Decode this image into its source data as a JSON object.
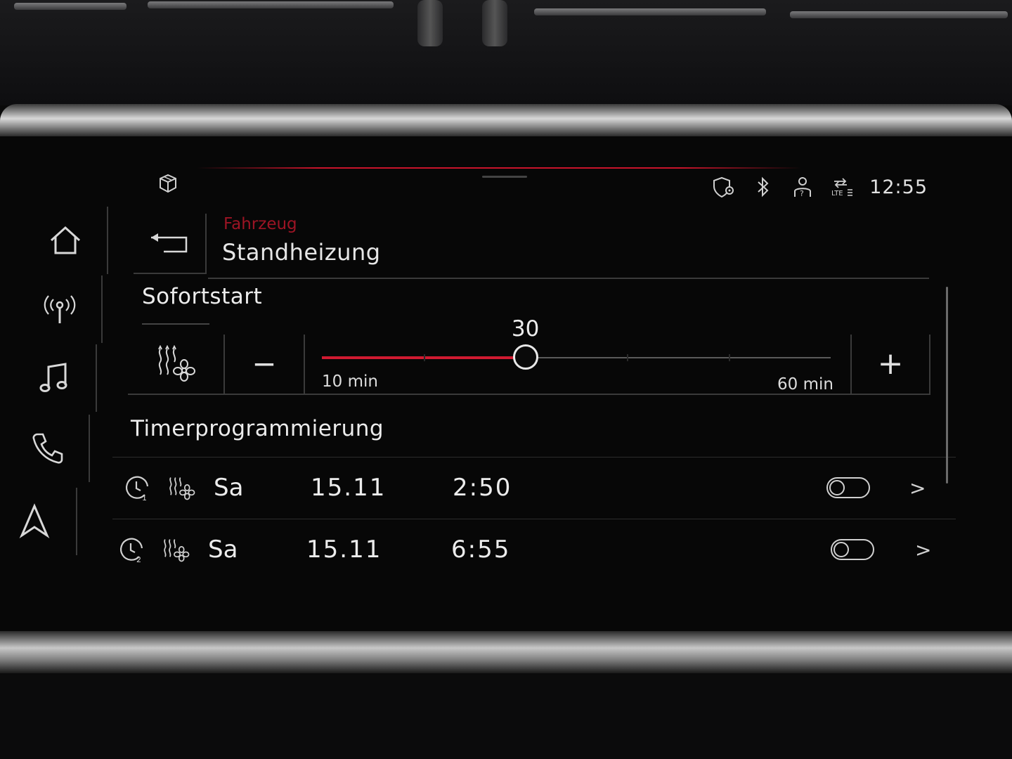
{
  "status_bar": {
    "time": "12:55",
    "icons": [
      "cube-icon",
      "shield-location-icon",
      "bluetooth-icon",
      "profile-help-icon",
      "lte-data-icon"
    ]
  },
  "nav": {
    "items": [
      {
        "name": "home-icon"
      },
      {
        "name": "radio-icon"
      },
      {
        "name": "music-icon"
      },
      {
        "name": "phone-icon"
      },
      {
        "name": "navigation-icon"
      }
    ]
  },
  "header": {
    "breadcrumb": "Fahrzeug",
    "title": "Standheizung",
    "back_icon": "back-arrow-icon"
  },
  "sofortstart": {
    "title": "Sofortstart",
    "mode_icon": "heater-fan-icon",
    "minus_label": "−",
    "plus_label": "+",
    "slider": {
      "value": 30,
      "value_label": "30",
      "min": 10,
      "max": 60,
      "min_label": "10 min",
      "max_label": "60 min"
    }
  },
  "timers": {
    "title": "Timerprogrammierung",
    "rows": [
      {
        "clock_icon": "timer-1-icon",
        "mode_icon": "heater-fan-icon",
        "day": "Sa",
        "date": "15.11",
        "time": "2:50",
        "enabled": false,
        "chevron": ">"
      },
      {
        "clock_icon": "timer-2-icon",
        "mode_icon": "heater-fan-icon",
        "day": "Sa",
        "date": "15.11",
        "time": "6:55",
        "enabled": false,
        "chevron": ">"
      }
    ]
  },
  "colors": {
    "accent_red": "#d01a30",
    "text": "#ececec",
    "background": "#070707"
  }
}
